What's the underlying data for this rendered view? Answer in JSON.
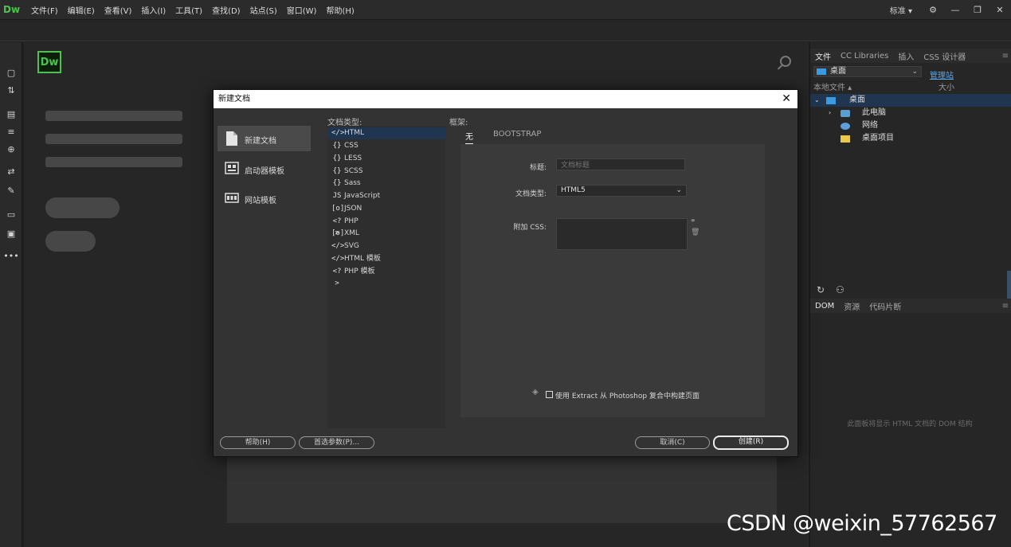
{
  "app": {
    "logo_text": "Dw"
  },
  "menubar": {
    "items": [
      "文件(F)",
      "编辑(E)",
      "查看(V)",
      "插入(I)",
      "工具(T)",
      "查找(D)",
      "站点(S)",
      "窗口(W)",
      "帮助(H)"
    ],
    "workspace": "标准",
    "workspace_chevron": "▾"
  },
  "dialog": {
    "title": "新建文档",
    "close_glyph": "✕",
    "categories": [
      {
        "label": "新建文档",
        "icon": "blank-document-icon"
      },
      {
        "label": "启动器模板",
        "icon": "starter-template-icon"
      },
      {
        "label": "网站模板",
        "icon": "site-template-icon"
      }
    ],
    "doc_types_heading": "文档类型:",
    "doc_types": [
      {
        "label": "HTML",
        "icon": "</>"
      },
      {
        "label": "CSS",
        "icon": "{}"
      },
      {
        "label": "LESS",
        "icon": "{}"
      },
      {
        "label": "SCSS",
        "icon": "{}"
      },
      {
        "label": "Sass",
        "icon": "{}"
      },
      {
        "label": "JavaScript",
        "icon": "JS"
      },
      {
        "label": "JSON",
        "icon": "[o]"
      },
      {
        "label": "PHP",
        "icon": "<?>"
      },
      {
        "label": "XML",
        "icon": "[o]"
      },
      {
        "label": "SVG",
        "icon": "</>"
      },
      {
        "label": "HTML 模板",
        "icon": "</>"
      },
      {
        "label": "PHP 模板",
        "icon": "<?>"
      }
    ],
    "framework_heading": "框架:",
    "framework_tabs": [
      "无",
      "BOOTSTRAP"
    ],
    "title_label": "标题:",
    "title_placeholder": "文档标题",
    "doctype_label": "文档类型:",
    "doctype_value": "HTML5",
    "attach_css_label": "附加 CSS:",
    "extract_label": "使用 Extract 从 Photoshop 复合中构建页面",
    "buttons": {
      "help": "帮助(H)",
      "prefs": "首选参数(P)...",
      "cancel": "取消(C)",
      "create": "创建(R)"
    }
  },
  "files_panel": {
    "tabs": [
      "文件",
      "CC Libraries",
      "插入",
      "CSS 设计器"
    ],
    "site_select": "桌面",
    "manage_link": "管理站",
    "header_name": "本地文件 ▴",
    "header_size": "大小",
    "tree": [
      {
        "label": "桌面",
        "icon": "desktop-icon",
        "level": 0,
        "expanded": true,
        "selected": true
      },
      {
        "label": "此电脑",
        "icon": "computer-icon",
        "level": 1,
        "expanded": false,
        "selected": false
      },
      {
        "label": "网络",
        "icon": "network-icon",
        "level": 1,
        "expanded": false,
        "selected": false
      },
      {
        "label": "桌面项目",
        "icon": "folder-icon",
        "level": 1,
        "expanded": false,
        "selected": false
      }
    ]
  },
  "dom_panel": {
    "tabs": [
      "DOM",
      "资源",
      "代码片断"
    ],
    "message": "此面板将显示 HTML 文档的 DOM 结构"
  },
  "watermark": "CSDN @weixin_57762567",
  "colors": {
    "accent_green": "#4ec24e",
    "selection_blue": "#1f3550",
    "link_blue": "#5aa6e8"
  }
}
